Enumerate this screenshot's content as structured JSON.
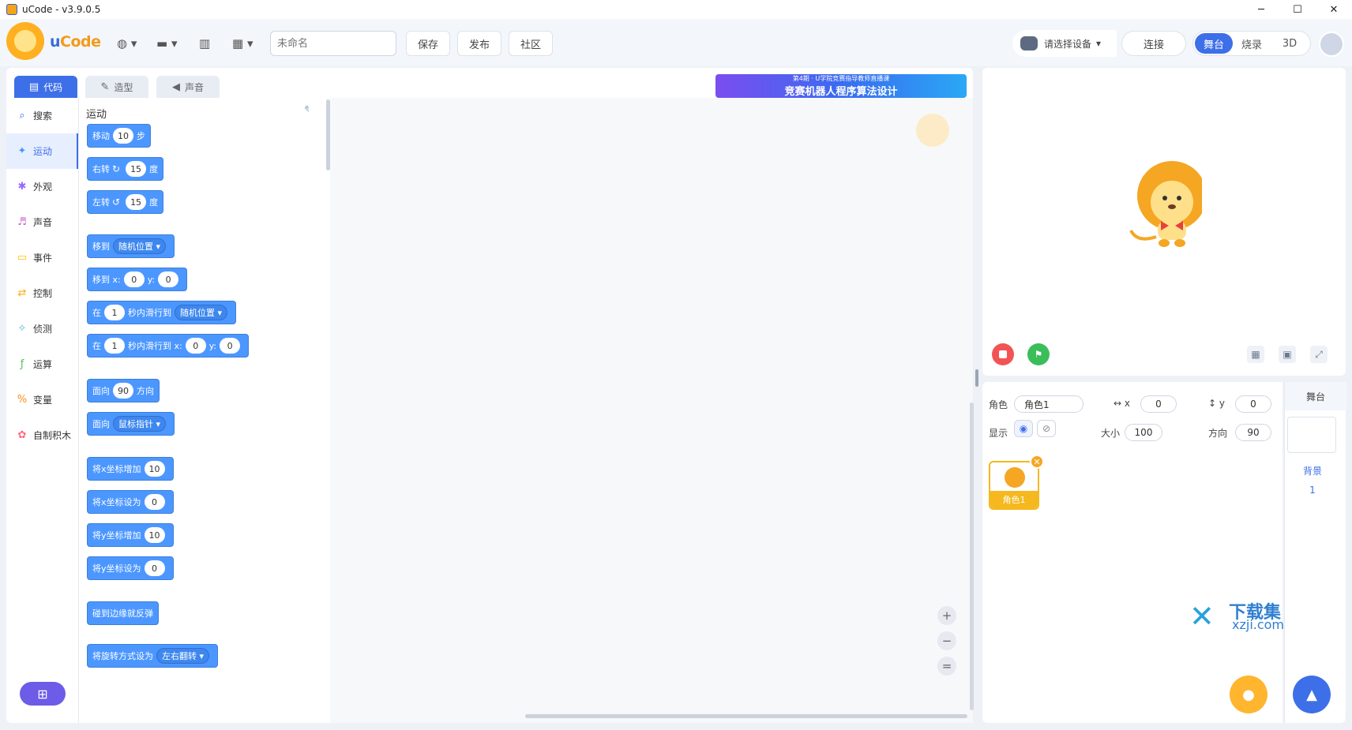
{
  "window": {
    "title": "uCode - v3.9.0.5",
    "minimize": "─",
    "maximize": "☐",
    "close": "✕"
  },
  "toolbar": {
    "brand_prefix": "u",
    "brand_rest": "Code",
    "project_name_placeholder": "未命名",
    "save_label": "保存",
    "publish_label": "发布",
    "community_label": "社区",
    "device_label": "请选择设备",
    "connect_label": "连接",
    "modes": [
      "舞台",
      "烧录",
      "3D"
    ]
  },
  "tabs": {
    "code": "代码",
    "costume": "造型",
    "sound": "声音"
  },
  "categories": [
    {
      "label": "搜索",
      "icon": "⌕",
      "color": "#3d6fe8"
    },
    {
      "label": "运动",
      "icon": "✦",
      "color": "#4c97ff"
    },
    {
      "label": "外观",
      "icon": "✱",
      "color": "#9966ff"
    },
    {
      "label": "声音",
      "icon": "♬",
      "color": "#cf63cf"
    },
    {
      "label": "事件",
      "icon": "▭",
      "color": "#ffbf00"
    },
    {
      "label": "控制",
      "icon": "⇄",
      "color": "#ffab19"
    },
    {
      "label": "侦测",
      "icon": "✧",
      "color": "#5cb1d6"
    },
    {
      "label": "运算",
      "icon": "ƒ",
      "color": "#59c059"
    },
    {
      "label": "变量",
      "icon": "%",
      "color": "#ff8c1a"
    },
    {
      "label": "自制积木",
      "icon": "✿",
      "color": "#ff6680"
    }
  ],
  "palette": {
    "heading": "运动",
    "blocks": {
      "move": {
        "a": "移动",
        "n": "10",
        "b": "步"
      },
      "turn_right": {
        "a": "右转",
        "n": "15",
        "b": "度"
      },
      "turn_left": {
        "a": "左转",
        "n": "15",
        "b": "度"
      },
      "goto": {
        "a": "移到",
        "dd": "随机位置"
      },
      "goto_xy": {
        "a": "移到 x:",
        "x": "0",
        "ylbl": "y:",
        "y": "0"
      },
      "glide": {
        "a": "在",
        "n": "1",
        "b": "秒内滑行到",
        "dd": "随机位置"
      },
      "glide_xy": {
        "a": "在",
        "n": "1",
        "b": "秒内滑行到 x:",
        "x": "0",
        "ylbl": "y:",
        "y": "0"
      },
      "point_dir": {
        "a": "面向",
        "n": "90",
        "b": "方向"
      },
      "point_to": {
        "a": "面向",
        "dd": "鼠标指针"
      },
      "change_x": {
        "a": "将x坐标增加",
        "n": "10"
      },
      "set_x": {
        "a": "将x坐标设为",
        "n": "0"
      },
      "change_y": {
        "a": "将y坐标增加",
        "n": "10"
      },
      "set_y": {
        "a": "将y坐标设为",
        "n": "0"
      },
      "bounce": {
        "a": "碰到边缘就反弹"
      },
      "rotation_style": {
        "a": "将旋转方式设为",
        "dd": "左右翻转"
      }
    }
  },
  "banner": {
    "small": "第4期 · U学院竞赛指导教师直播课",
    "main": "竞赛机器人程序算法设计"
  },
  "zoom": {
    "in": "+",
    "out": "−",
    "reset": "="
  },
  "sprite": {
    "name_label": "角色",
    "name": "角色1",
    "x_label": "x",
    "x": "0",
    "y_label": "y",
    "y": "0",
    "show_label": "显示",
    "size_label": "大小",
    "size": "100",
    "dir_label": "方向",
    "dir": "90",
    "card_label": "角色1"
  },
  "stage_col": {
    "head": "舞台",
    "backdrop_label": "背景",
    "backdrop_count": "1"
  },
  "watermark": {
    "text": "下载集",
    "domain": "xzji.com"
  }
}
